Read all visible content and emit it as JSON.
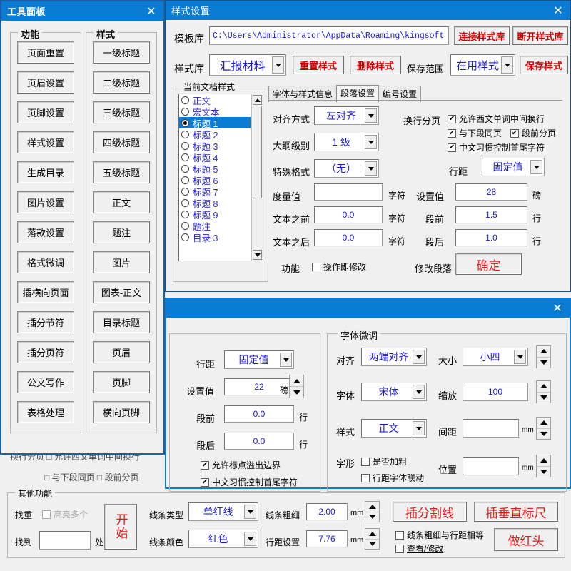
{
  "tool_panel": {
    "title": "工具面板",
    "close_label": "✕",
    "group_function": "功能",
    "group_style": "样式",
    "function_buttons": [
      "页面重置",
      "页眉设置",
      "页脚设置",
      "样式设置",
      "生成目录",
      "图片设置",
      "落款设置",
      "格式微调",
      "插横向页面",
      "插分节符",
      "插分页符",
      "公文写作",
      "表格处理"
    ],
    "style_buttons": [
      "一级标题",
      "二级标题",
      "三级标题",
      "四级标题",
      "五级标题",
      "正文",
      "题注",
      "图片",
      "图表-正文",
      "目录标题",
      "页眉",
      "页脚",
      "横向页脚"
    ]
  },
  "style_dialog": {
    "title": "样式设置",
    "close_label": "✕",
    "template_lib_label": "模板库",
    "template_lib_path": "C:\\Users\\Administrator\\AppData\\Roaming\\kingsoft",
    "connect_button": "连接样式库",
    "disconnect_button": "断开样式库",
    "style_lib_label": "样式库",
    "style_lib_value": "汇报材料",
    "reset_button": "重置样式",
    "delete_button": "删除样式",
    "save_scope_label": "保存范围",
    "save_scope_value": "在用样式",
    "save_button": "保存样式",
    "current_doc_styles_label": "当前文档样式",
    "style_list": [
      {
        "label": "正文",
        "selected": false
      },
      {
        "label": "宏文本",
        "selected": false
      },
      {
        "label": "标题 1",
        "selected": true
      },
      {
        "label": "标题 2",
        "selected": false
      },
      {
        "label": "标题 3",
        "selected": false
      },
      {
        "label": "标题 4",
        "selected": false
      },
      {
        "label": "标题 5",
        "selected": false
      },
      {
        "label": "标题 6",
        "selected": false
      },
      {
        "label": "标题 7",
        "selected": false
      },
      {
        "label": "标题 8",
        "selected": false
      },
      {
        "label": "标题 9",
        "selected": false
      },
      {
        "label": "题注",
        "selected": false
      },
      {
        "label": "目录 3",
        "selected": false
      }
    ],
    "tabs": [
      {
        "label": "字体与样式信息",
        "active": false
      },
      {
        "label": "段落设置",
        "active": true
      },
      {
        "label": "编号设置",
        "active": false
      }
    ],
    "align_label": "对齐方式",
    "align_value": "左对齐",
    "outline_label": "大纲级别",
    "outline_value": "1 级",
    "special_label": "特殊格式",
    "special_value": "（无）",
    "measure_label": "度量值",
    "measure_value": "",
    "measure_unit": "字符",
    "before_text_label": "文本之前",
    "before_text_value": "0.0",
    "before_text_unit": "字符",
    "after_text_label": "文本之后",
    "after_text_value": "0.0",
    "after_text_unit": "字符",
    "pagination_label": "换行分页",
    "chk_latin_break": "允许西文单词中间换行",
    "chk_keep_with_next": "与下段同页",
    "chk_page_break_before": "段前分页",
    "chk_chinese_punct": "中文习惯控制首尾字符",
    "line_spacing_label": "行距",
    "line_spacing_value": "固定值",
    "set_value_label": "设置值",
    "set_value": "28",
    "set_value_unit": "磅",
    "space_before_label": "段前",
    "space_before_value": "1.5",
    "space_before_unit": "行",
    "space_after_label": "段后",
    "space_after_value": "1.0",
    "space_after_unit": "行",
    "function_label": "功能",
    "chk_apply_immediately": "操作即修改",
    "modify_para_label": "修改段落",
    "confirm_button": "确定"
  },
  "tune_dialog": {
    "title": "",
    "close_label": "✕",
    "para": {
      "line_spacing_label": "行距",
      "line_spacing_value": "固定值",
      "set_value_label": "设置值",
      "set_value": "22",
      "set_value_unit": "磅",
      "space_before_label": "段前",
      "space_before_value": "0.0",
      "space_before_unit": "行",
      "space_after_label": "段后",
      "space_after_value": "0.0",
      "space_after_unit": "行",
      "chk_punct_overflow": "允许标点溢出边界",
      "chk_chinese_punct": "中文习惯控制首尾字符"
    },
    "font": {
      "group_label": "字体微调",
      "align_label": "对齐",
      "align_value": "两端对齐",
      "size_label": "大小",
      "size_value": "小四",
      "font_label": "字体",
      "font_value": "宋体",
      "scale_label": "缩放",
      "scale_value": "100",
      "style_label": "样式",
      "style_value": "正文",
      "spacing_label": "间距",
      "spacing_value": "",
      "spacing_unit": "mm",
      "glyph_label": "字形",
      "chk_bold": "是否加粗",
      "chk_link_spacing": "行距字体联动",
      "position_label": "位置",
      "position_value": "",
      "position_unit": "mm"
    }
  },
  "background_clipped": {
    "line1": "换行分页  □ 允许西文单词中间换行",
    "line2": "□ 与下段同页  □ 段前分页"
  },
  "other_functions": {
    "group_label": "其他功能",
    "find_dup_label": "找重",
    "chk_highlight_many": "高亮多个",
    "found_label": "找到",
    "found_value": "",
    "found_unit": "处",
    "start_button": "开始",
    "line_type_label": "线条类型",
    "line_type_value": "单红线",
    "line_color_label": "线条颜色",
    "line_color_value": "红色",
    "line_width_label": "线条粗细",
    "line_width_value": "2.00",
    "line_width_unit": "mm",
    "line_spacing_label": "行距设置",
    "line_spacing_value": "7.76",
    "line_spacing_unit": "mm",
    "insert_divider_button": "插分割线",
    "insert_ruler_button": "插垂直标尺",
    "chk_width_equals_spacing": "线条粗细与行距相等",
    "chk_view_modify": "查看/修改",
    "red_header_button": "做红头"
  },
  "colors": {
    "titlebar": "#0a7cd4",
    "accent_blue": "#1a1ad0",
    "accent_red": "#cc0000",
    "window_bg": "#f0f0f0",
    "selection": "#0a7cd4"
  }
}
